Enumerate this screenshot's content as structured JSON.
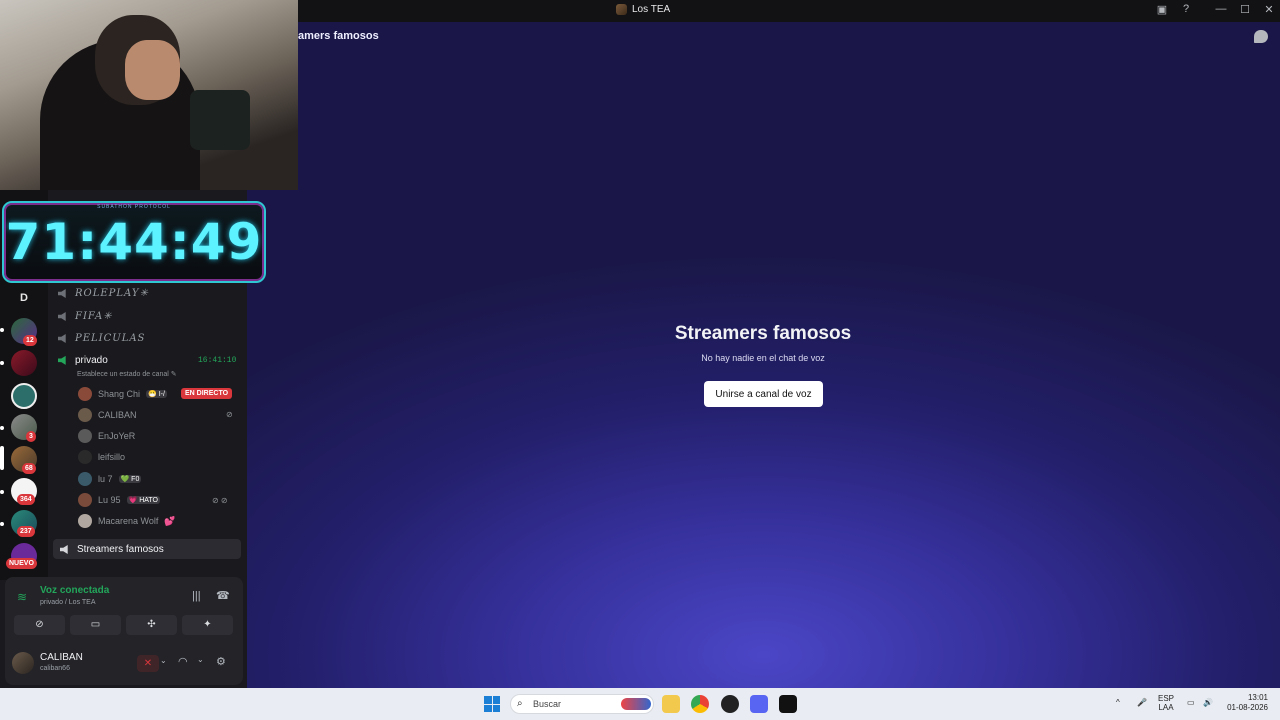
{
  "window": {
    "title": "Los TEA"
  },
  "header": {
    "channel": "amers famosos"
  },
  "overlay": {
    "timer_caption": "SUBATHON PROTOCOL",
    "timer": "71:44:49"
  },
  "guilds": [
    {
      "letter": "D"
    },
    {
      "badge": "12"
    },
    {
      "badge": ""
    },
    {
      "badge": ""
    },
    {
      "badge": "3"
    },
    {
      "badge": "68"
    },
    {
      "badge": "364"
    },
    {
      "badge": "237"
    },
    {
      "badge": "NUEVO"
    }
  ],
  "channels": [
    {
      "name": "ROLEPLAY✳"
    },
    {
      "name": "FIFA✳"
    },
    {
      "name": "PELICULAS"
    }
  ],
  "privado": {
    "name": "privado",
    "time": "16:41:10",
    "status": "Establece un estado de canal ✎",
    "members": [
      {
        "name": "Shang Chi",
        "tag": "😷 I-/",
        "live": "EN DIRECTO"
      },
      {
        "name": "CALIBAN",
        "tag": ""
      },
      {
        "name": "EnJoYeR",
        "tag": ""
      },
      {
        "name": "leifsillo",
        "tag": ""
      },
      {
        "name": "lu 7",
        "tag": "💚 F0"
      },
      {
        "name": "Lu 95",
        "tag": "💗 HATO"
      },
      {
        "name": "Macarena Wolf",
        "tag": "💕"
      }
    ]
  },
  "active_channel": {
    "name": "Streamers famosos"
  },
  "voice": {
    "title": "Voz conectada",
    "subtitle": "privado / Los TEA"
  },
  "user": {
    "name": "CALIBAN",
    "tag": "caliban66"
  },
  "main": {
    "title": "Streamers famosos",
    "subtitle": "No hay nadie en el chat de voz",
    "join_label": "Unirse a canal de voz"
  },
  "taskbar": {
    "search_placeholder": "Buscar",
    "lang_top": "ESP",
    "lang_bottom": "LAA",
    "time": "13:01",
    "date": "01-08-2026"
  },
  "colors": {
    "accent_green": "#23a55a",
    "danger": "#da373c",
    "timer": "#5df2ff"
  }
}
